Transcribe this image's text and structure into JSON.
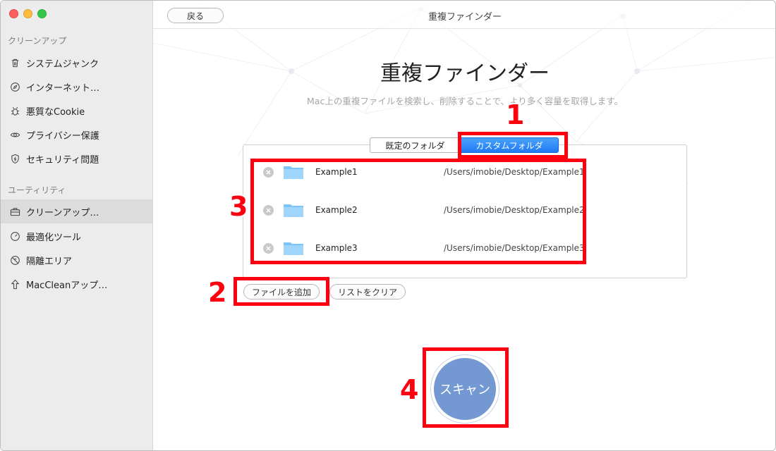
{
  "window": {
    "title": "重複ファインダー"
  },
  "toolbar": {
    "back_label": "戻る"
  },
  "sidebar": {
    "sections": [
      {
        "label": "クリーンアップ"
      },
      {
        "label": "ユーティリティ"
      }
    ],
    "items": [
      {
        "label": "システムジャンク",
        "icon": "trash-icon"
      },
      {
        "label": "インターネット…",
        "icon": "compass-icon"
      },
      {
        "label": "悪質なCookie",
        "icon": "bug-icon"
      },
      {
        "label": "プライバシー保護",
        "icon": "eye-icon"
      },
      {
        "label": "セキュリティ問題",
        "icon": "shield-icon"
      },
      {
        "label": "クリーンアップ…",
        "icon": "toolbox-icon",
        "active": true
      },
      {
        "label": "最適化ツール",
        "icon": "gauge-icon"
      },
      {
        "label": "隔離エリア",
        "icon": "quarantine-icon"
      },
      {
        "label": "MacCleanアップ…",
        "icon": "upload-arrow-icon"
      }
    ]
  },
  "main": {
    "title": "重複ファインダー",
    "subtitle": "Mac上の重複ファイルを検索し、削除することで、より多く容量を取得します。",
    "tabs": [
      {
        "label": "既定のフォルダ",
        "selected": false
      },
      {
        "label": "カスタムフォルダ",
        "selected": true
      }
    ],
    "folders": [
      {
        "name": "Example1",
        "path": "/Users/imobie/Desktop/Example1"
      },
      {
        "name": "Example2",
        "path": "/Users/imobie/Desktop/Example2"
      },
      {
        "name": "Example3",
        "path": "/Users/imobie/Desktop/Example3"
      }
    ],
    "add_file_label": "ファイルを追加",
    "clear_list_label": "リストをクリア",
    "scan_label": "スキャン"
  },
  "annotations": [
    "1",
    "2",
    "3",
    "4"
  ],
  "colors": {
    "accent_blue": "#1f7af2",
    "scan_button": "#7499d2",
    "annotation_red": "#ff0010",
    "sidebar_bg": "#ececec"
  }
}
